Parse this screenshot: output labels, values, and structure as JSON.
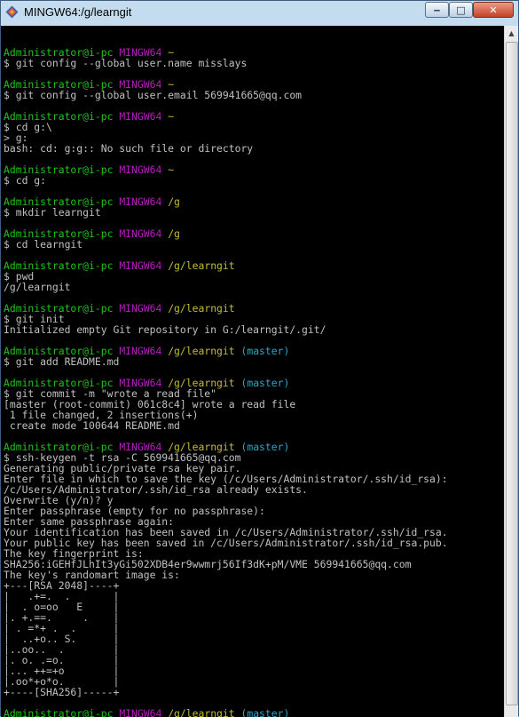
{
  "window": {
    "title": "MINGW64:/g/learngit",
    "controls": {
      "minimize": "‒",
      "maximize": "□",
      "close": "✕"
    }
  },
  "colors": {
    "user_host": "#22c11a",
    "env": "#b61cbf",
    "path": "#c2bb32",
    "branch": "#2aa6c6",
    "text": "#c0c0c0",
    "background": "#000000"
  },
  "terminal": {
    "lines": [
      "",
      "Administrator@i-pc MINGW64 ~",
      "$ git config --global user.name misslays",
      "",
      "Administrator@i-pc MINGW64 ~",
      "$ git config --global user.email 569941665@qq.com",
      "",
      "Administrator@i-pc MINGW64 ~",
      "$ cd g:\\",
      "> g:",
      "bash: cd: g:g:: No such file or directory",
      "",
      "Administrator@i-pc MINGW64 ~",
      "$ cd g:",
      "",
      "Administrator@i-pc MINGW64 /g",
      "$ mkdir learngit",
      "",
      "Administrator@i-pc MINGW64 /g",
      "$ cd learngit",
      "",
      "Administrator@i-pc MINGW64 /g/learngit",
      "$ pwd",
      "/g/learngit",
      "",
      "Administrator@i-pc MINGW64 /g/learngit",
      "$ git init",
      "Initialized empty Git repository in G:/learngit/.git/",
      "",
      "Administrator@i-pc MINGW64 /g/learngit (master)",
      "$ git add README.md",
      "",
      "Administrator@i-pc MINGW64 /g/learngit (master)",
      "$ git commit -m \"wrote a read file\"",
      "[master (root-commit) 061c8c4] wrote a read file",
      " 1 file changed, 2 insertions(+)",
      " create mode 100644 README.md",
      "",
      "Administrator@i-pc MINGW64 /g/learngit (master)",
      "$ ssh-keygen -t rsa -C 569941665@qq.com",
      "Generating public/private rsa key pair.",
      "Enter file in which to save the key (/c/Users/Administrator/.ssh/id_rsa):",
      "/c/Users/Administrator/.ssh/id_rsa already exists.",
      "Overwrite (y/n)? y",
      "Enter passphrase (empty for no passphrase):",
      "Enter same passphrase again:",
      "Your identification has been saved in /c/Users/Administrator/.ssh/id_rsa.",
      "Your public key has been saved in /c/Users/Administrator/.ssh/id_rsa.pub.",
      "The key fingerprint is:",
      "SHA256:iGEHfJLhIt3yGi502XDB4er9wwmrj56If3dK+pM/VME 569941665@qq.com",
      "The key's randomart image is:",
      "+---[RSA 2048]----+",
      "|   .+=.  .       |",
      "|  . o=oo   E     |",
      "|. +.==.     .    |",
      "| . =*+ .  .      |",
      "|  ..+o.. S.      |",
      "|..oo..  .        |",
      "|. o. .=o.        |",
      "|... ++=+o        |",
      "|.oo*+o*o.        |",
      "+----[SHA256]-----+",
      "",
      "Administrator@i-pc MINGW64 /g/learngit (master)",
      "$ "
    ]
  }
}
